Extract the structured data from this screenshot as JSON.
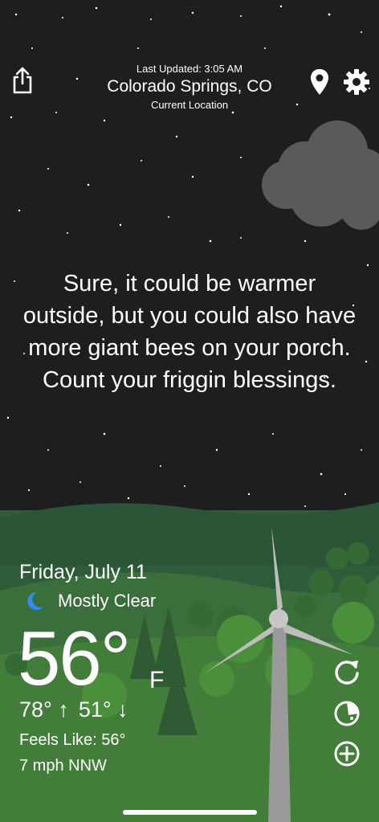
{
  "header": {
    "last_updated": "Last Updated: 3:05 AM",
    "city": "Colorado Springs, CO",
    "location_label": "Current Location"
  },
  "icons": {
    "share": "share-icon",
    "location": "location-pin-icon",
    "settings": "gear-icon",
    "refresh": "refresh-icon",
    "radar": "radar-icon",
    "add": "add-icon",
    "moon": "moon-icon"
  },
  "message": "Sure, it could be warmer outside, but you could also have more giant bees on your porch. Count your friggin blessings.",
  "weather": {
    "date": "Friday, July 11",
    "condition": "Mostly Clear",
    "temperature": "56°",
    "unit": "F",
    "high": "78° ↑",
    "low": "51° ↓",
    "feels_like": "Feels Like: 56°",
    "wind": "7 mph NNW"
  },
  "colors": {
    "sky": "#1e1e20",
    "grass": "#3f7a38",
    "hills": "#2f5c3a",
    "moon": "#2f8cff"
  }
}
